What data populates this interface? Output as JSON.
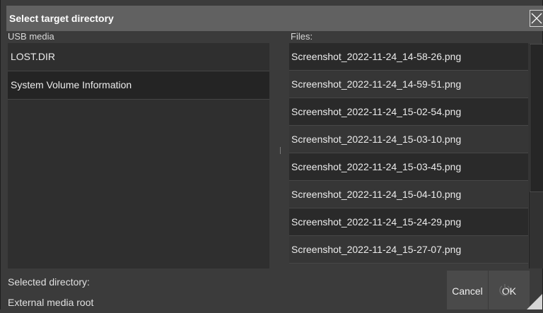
{
  "dialog": {
    "title": "Select target directory"
  },
  "left_pane": {
    "label": "USB media",
    "items": [
      "LOST.DIR",
      "System Volume Information"
    ]
  },
  "right_pane": {
    "label": "Files:",
    "files": [
      "Screenshot_2022-11-24_14-58-26.png",
      "Screenshot_2022-11-24_14-59-51.png",
      "Screenshot_2022-11-24_15-02-54.png",
      "Screenshot_2022-11-24_15-03-10.png",
      "Screenshot_2022-11-24_15-03-45.png",
      "Screenshot_2022-11-24_15-04-10.png",
      "Screenshot_2022-11-24_15-24-29.png",
      "Screenshot_2022-11-24_15-27-07.png"
    ]
  },
  "footer": {
    "selected_label": "Selected directory:",
    "selected_value": "External media root",
    "cancel_label": "Cancel",
    "ok_label": "OK"
  },
  "icons": {
    "close": "close-icon",
    "power": "power-icon"
  }
}
